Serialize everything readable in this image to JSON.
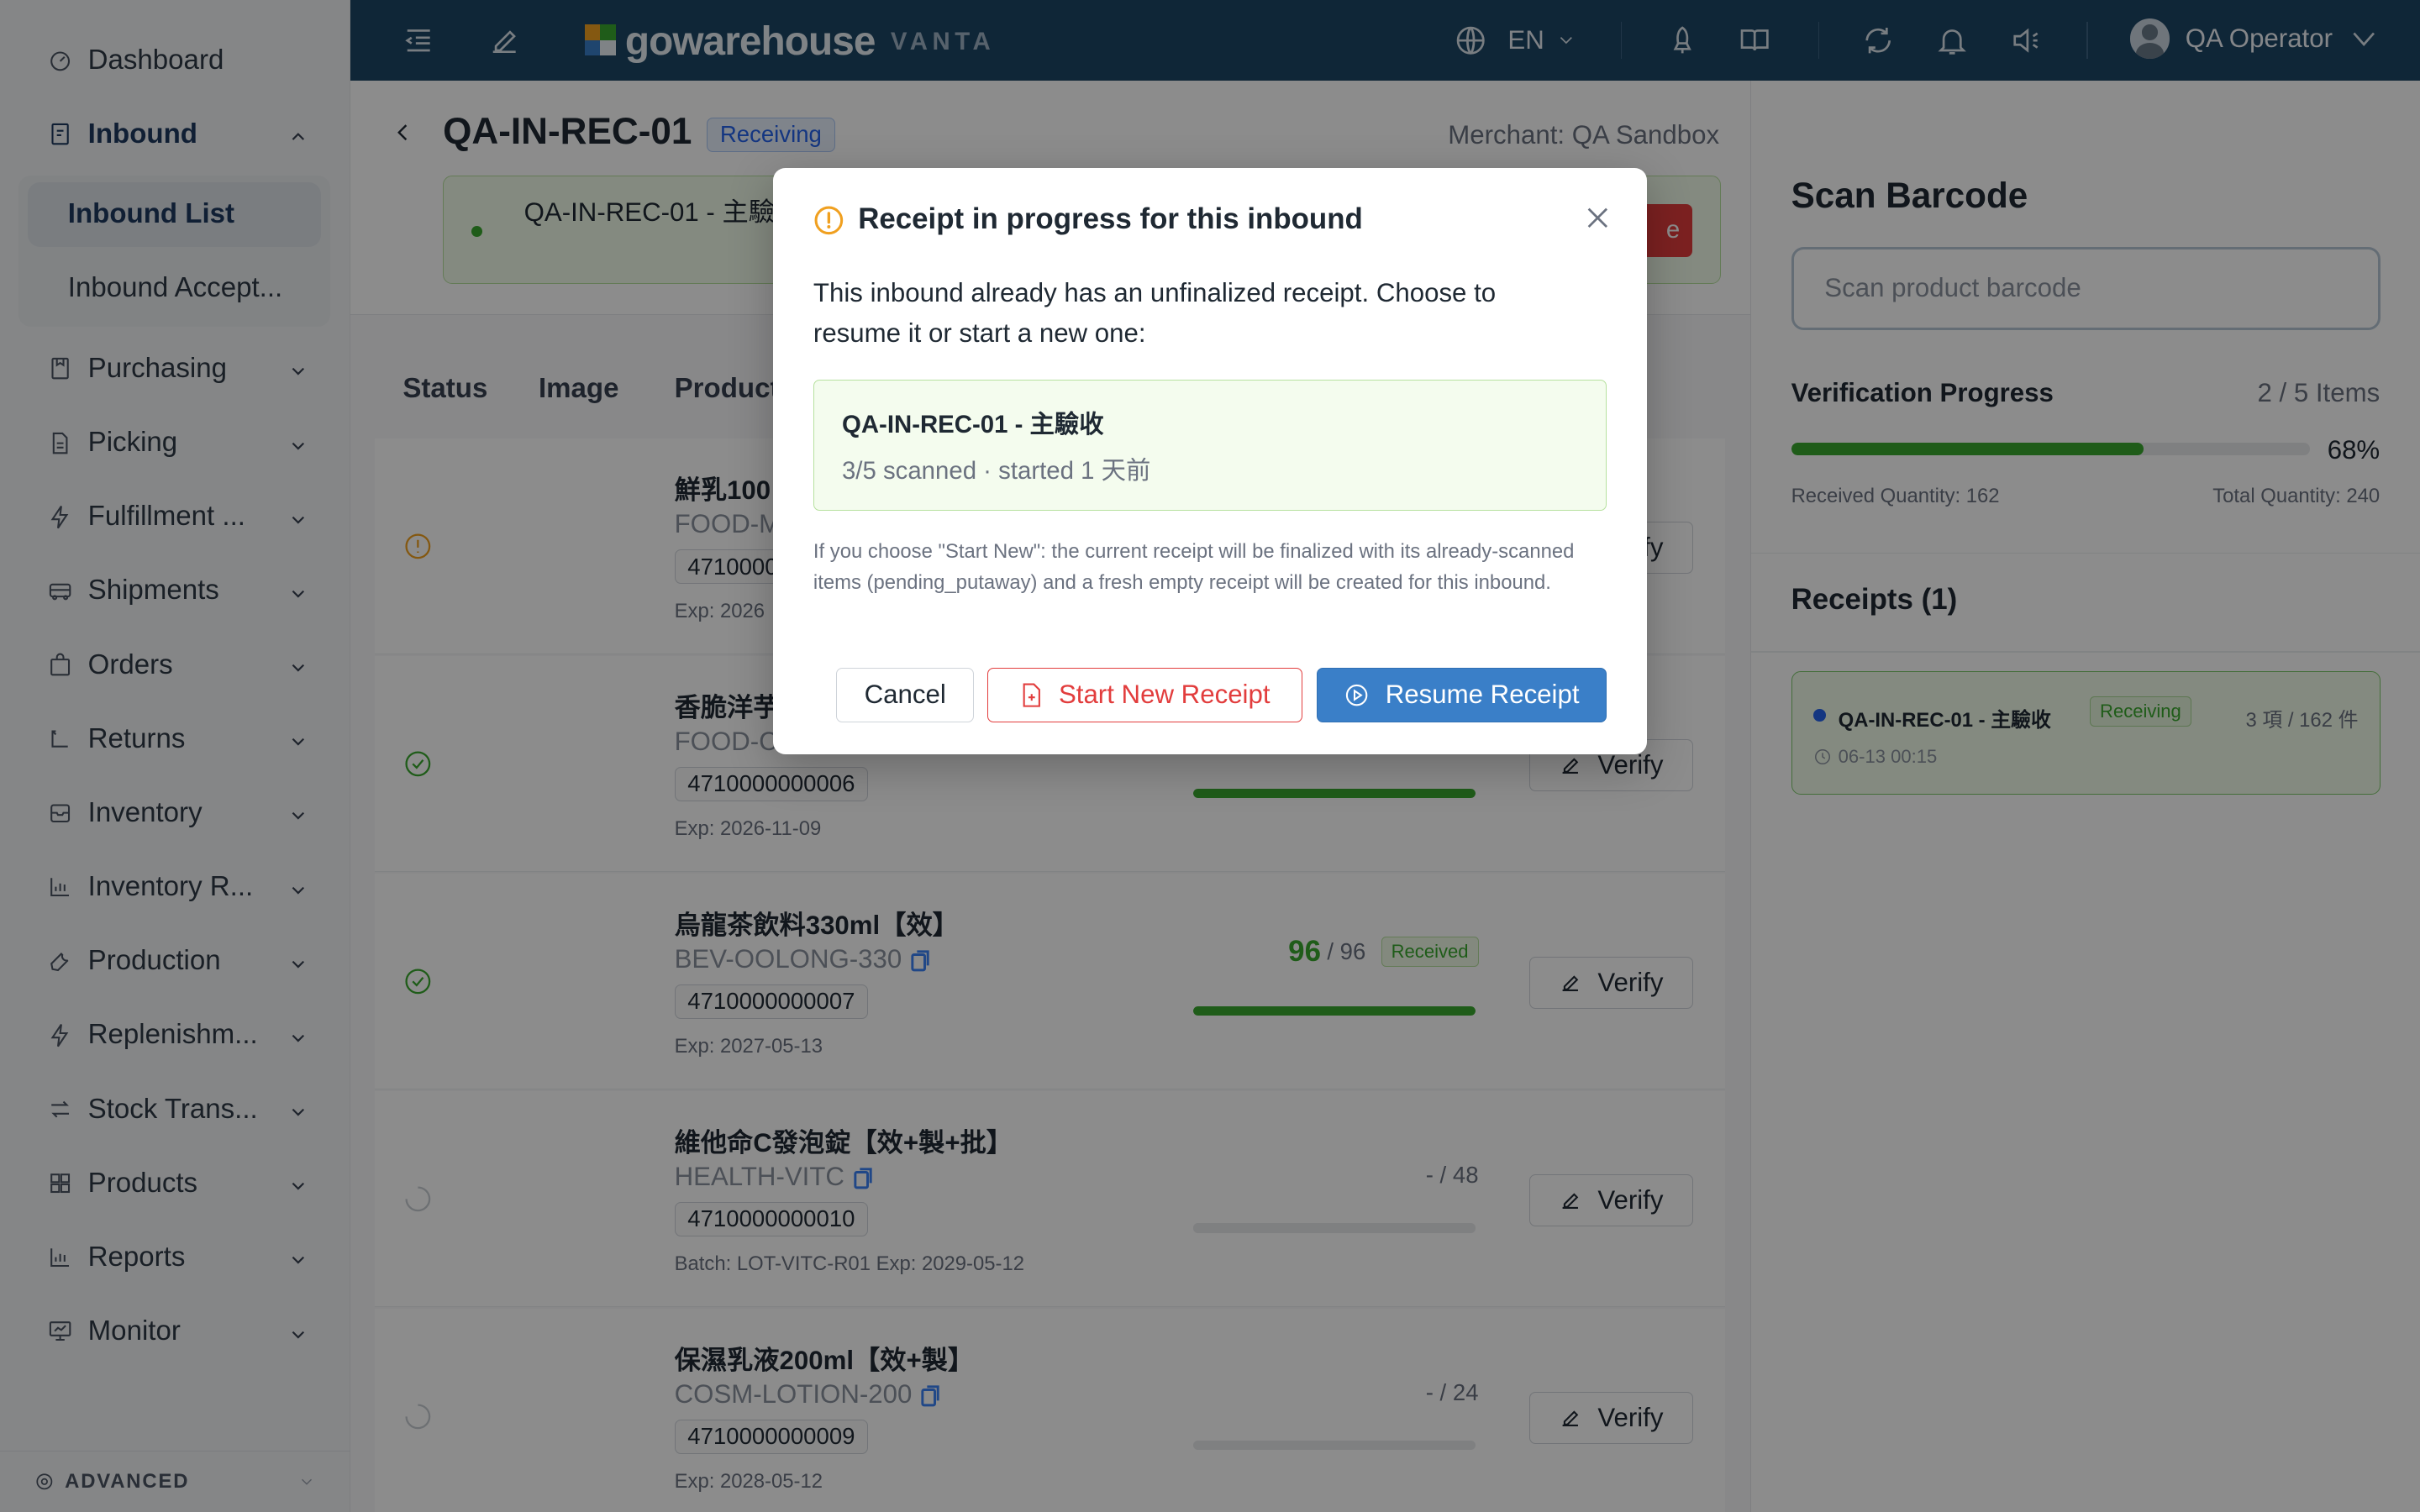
{
  "sidebar": {
    "items": [
      {
        "label": "Dashboard",
        "icon": "dashboard-icon"
      },
      {
        "label": "Inbound",
        "icon": "inbound-icon"
      },
      {
        "label": "Purchasing",
        "icon": "purchasing-icon"
      },
      {
        "label": "Picking",
        "icon": "picking-icon"
      },
      {
        "label": "Fulfillment ...",
        "icon": "lightning-icon"
      },
      {
        "label": "Shipments",
        "icon": "truck-icon"
      },
      {
        "label": "Orders",
        "icon": "bag-icon"
      },
      {
        "label": "Returns",
        "icon": "return-icon"
      },
      {
        "label": "Inventory",
        "icon": "box-icon"
      },
      {
        "label": "Inventory R...",
        "icon": "bar-chart-icon"
      },
      {
        "label": "Production",
        "icon": "wrench-icon"
      },
      {
        "label": "Replenishm...",
        "icon": "lightning-icon"
      },
      {
        "label": "Stock Trans...",
        "icon": "transfer-icon"
      },
      {
        "label": "Products",
        "icon": "grid-icon"
      },
      {
        "label": "Reports",
        "icon": "bar-chart-icon"
      },
      {
        "label": "Monitor",
        "icon": "monitor-icon"
      }
    ],
    "sub_items": [
      "Inbound List",
      "Inbound Accept..."
    ],
    "advanced_label": "ADVANCED"
  },
  "topbar": {
    "logo_text": "gowarehouse",
    "logo_sub": "VANTA",
    "language": "EN",
    "user_name": "QA Operator"
  },
  "page": {
    "title": "QA-IN-REC-01",
    "status": "Receiving",
    "merchant": "Merchant: QA Sandbox",
    "banner_text": "QA-IN-REC-01 - 主驗收",
    "banner_button": "e"
  },
  "table": {
    "headers": [
      "Status",
      "Image",
      "Product"
    ],
    "verify_label": "Verify",
    "received_label": "Received",
    "rows": [
      {
        "name": "鮮乳100",
        "sku": "FOOD-M",
        "barcode": "4710000",
        "exp": "Exp: 2026",
        "qty_got": "",
        "qty_total": "",
        "fill": 0,
        "status": "warning-icon"
      },
      {
        "name": "香脆洋芋",
        "sku": "FOOD-C",
        "barcode": "4710000000006",
        "exp": "Exp: 2026-11-09",
        "qty_got": "",
        "qty_total": "",
        "fill": 1,
        "status": "check-circle-icon"
      },
      {
        "name": "烏龍茶飲料330ml【效】",
        "sku": "BEV-OOLONG-330",
        "barcode": "4710000000007",
        "exp": "Exp: 2027-05-13",
        "qty_got": "96",
        "qty_total": "/ 96",
        "fill": 1,
        "status": "check-circle-icon"
      },
      {
        "name": "維他命C發泡錠【效+製+批】",
        "sku": "HEALTH-VITC",
        "barcode": "4710000000010",
        "exp": "Batch: LOT-VITC-R01  Exp: 2029-05-12",
        "qty_got": "",
        "qty_total": "- / 48",
        "fill": 0,
        "status": "pending-icon"
      },
      {
        "name": "保濕乳液200ml【效+製】",
        "sku": "COSM-LOTION-200",
        "barcode": "4710000000009",
        "exp": "Exp: 2028-05-12",
        "qty_got": "",
        "qty_total": "- / 24",
        "fill": 0,
        "status": "pending-icon"
      }
    ]
  },
  "right_panel": {
    "scan_title": "Scan Barcode",
    "scan_placeholder": "Scan product barcode",
    "progress_label": "Verification Progress",
    "progress_count": "2 / 5 Items",
    "progress_pct": "68%",
    "progress_fraction": 0.68,
    "received_qty": "Received Quantity: 162",
    "total_qty": "Total Quantity: 240",
    "receipts_title": "Receipts (1)",
    "receipt": {
      "name": "QA-IN-REC-01 - 主驗收",
      "status": "Receiving",
      "count": "3 項 / 162 件",
      "time": "06-13 00:15"
    }
  },
  "modal": {
    "title": "Receipt in progress for this inbound",
    "body": "This inbound already has an unfinalized receipt. Choose to resume it or start a new one:",
    "card_name": "QA-IN-REC-01 - 主驗收",
    "card_meta": "3/5 scanned · started 1 天前",
    "note": "If you choose \"Start New\": the current receipt will be finalized with its already-scanned items (pending_putaway) and a fresh empty receipt will be created for this inbound.",
    "cancel_label": "Cancel",
    "start_new_label": "Start New Receipt",
    "resume_label": "Resume Receipt"
  },
  "colors": {
    "topbar": "#1d4565",
    "success": "#3aa82e",
    "danger": "#e23d3d",
    "primary": "#3a7fc8",
    "warning": "#f0a020"
  }
}
